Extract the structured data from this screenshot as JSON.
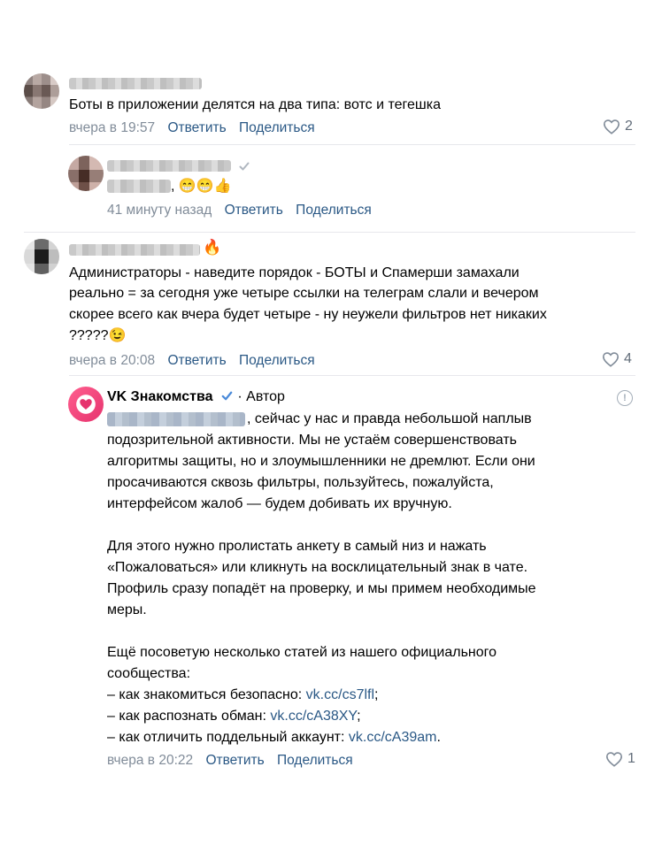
{
  "comments": [
    {
      "text": "Боты в приложении делятся на два типа: вотс и тегешка",
      "time": "вчера в 19:57",
      "reply_label": "Ответить",
      "share_label": "Поделиться",
      "likes": "2"
    },
    {
      "text_suffix": ", 😁😁👍",
      "time": "41 минуту назад",
      "reply_label": "Ответить",
      "share_label": "Поделиться"
    },
    {
      "name_emoji": "🔥",
      "lines": [
        "Администраторы - наведите порядок - БОТЫ и Спамерши замахали",
        "реально = за сегодня уже четыре ссылки на телеграм слали и вечером",
        "скорее всего как вчера будет четыре - ну неужели фильтров нет никаких",
        "?????😉"
      ],
      "time": "вчера в 20:08",
      "reply_label": "Ответить",
      "share_label": "Поделиться",
      "likes": "4"
    }
  ],
  "reply": {
    "author": "VK Знакомства",
    "author_tag": "· Автор",
    "report_icon": "!",
    "first_line": ", сейчас у нас и правда небольшой наплыв",
    "para1": [
      "подозрительной активности. Мы не устаём совершенствовать",
      "алгоритмы защиты, но и злоумышленники не дремлют. Если они",
      "просачиваются сквозь фильтры, пользуйтесь, пожалуйста,",
      "интерфейсом жалоб — будем добивать их вручную."
    ],
    "para2": [
      "Для этого нужно пролистать анкету в самый низ и нажать",
      "«Пожаловаться» или кликнуть на восклицательный знак в чате.",
      "Профиль сразу попадёт на проверку, и мы примем необходимые",
      "меры."
    ],
    "para3": [
      "Ещё посоветую несколько статей из нашего официального",
      "сообщества:"
    ],
    "links": [
      {
        "prefix": "– как знакомиться безопасно: ",
        "url": "vk.cc/cs7lfl",
        "suffix": ";"
      },
      {
        "prefix": "– как распознать обман: ",
        "url": "vk.cc/cA38XY",
        "suffix": ";"
      },
      {
        "prefix": "– как отличить поддельный аккаунт: ",
        "url": "vk.cc/cA39am",
        "suffix": "."
      }
    ],
    "time": "вчера в 20:22",
    "reply_label": "Ответить",
    "share_label": "Поделиться",
    "likes": "1"
  },
  "colors": {
    "link": "#2a5885",
    "meta": "#818c99",
    "brand": "#e6336e",
    "verified": "#4a8ad9"
  }
}
